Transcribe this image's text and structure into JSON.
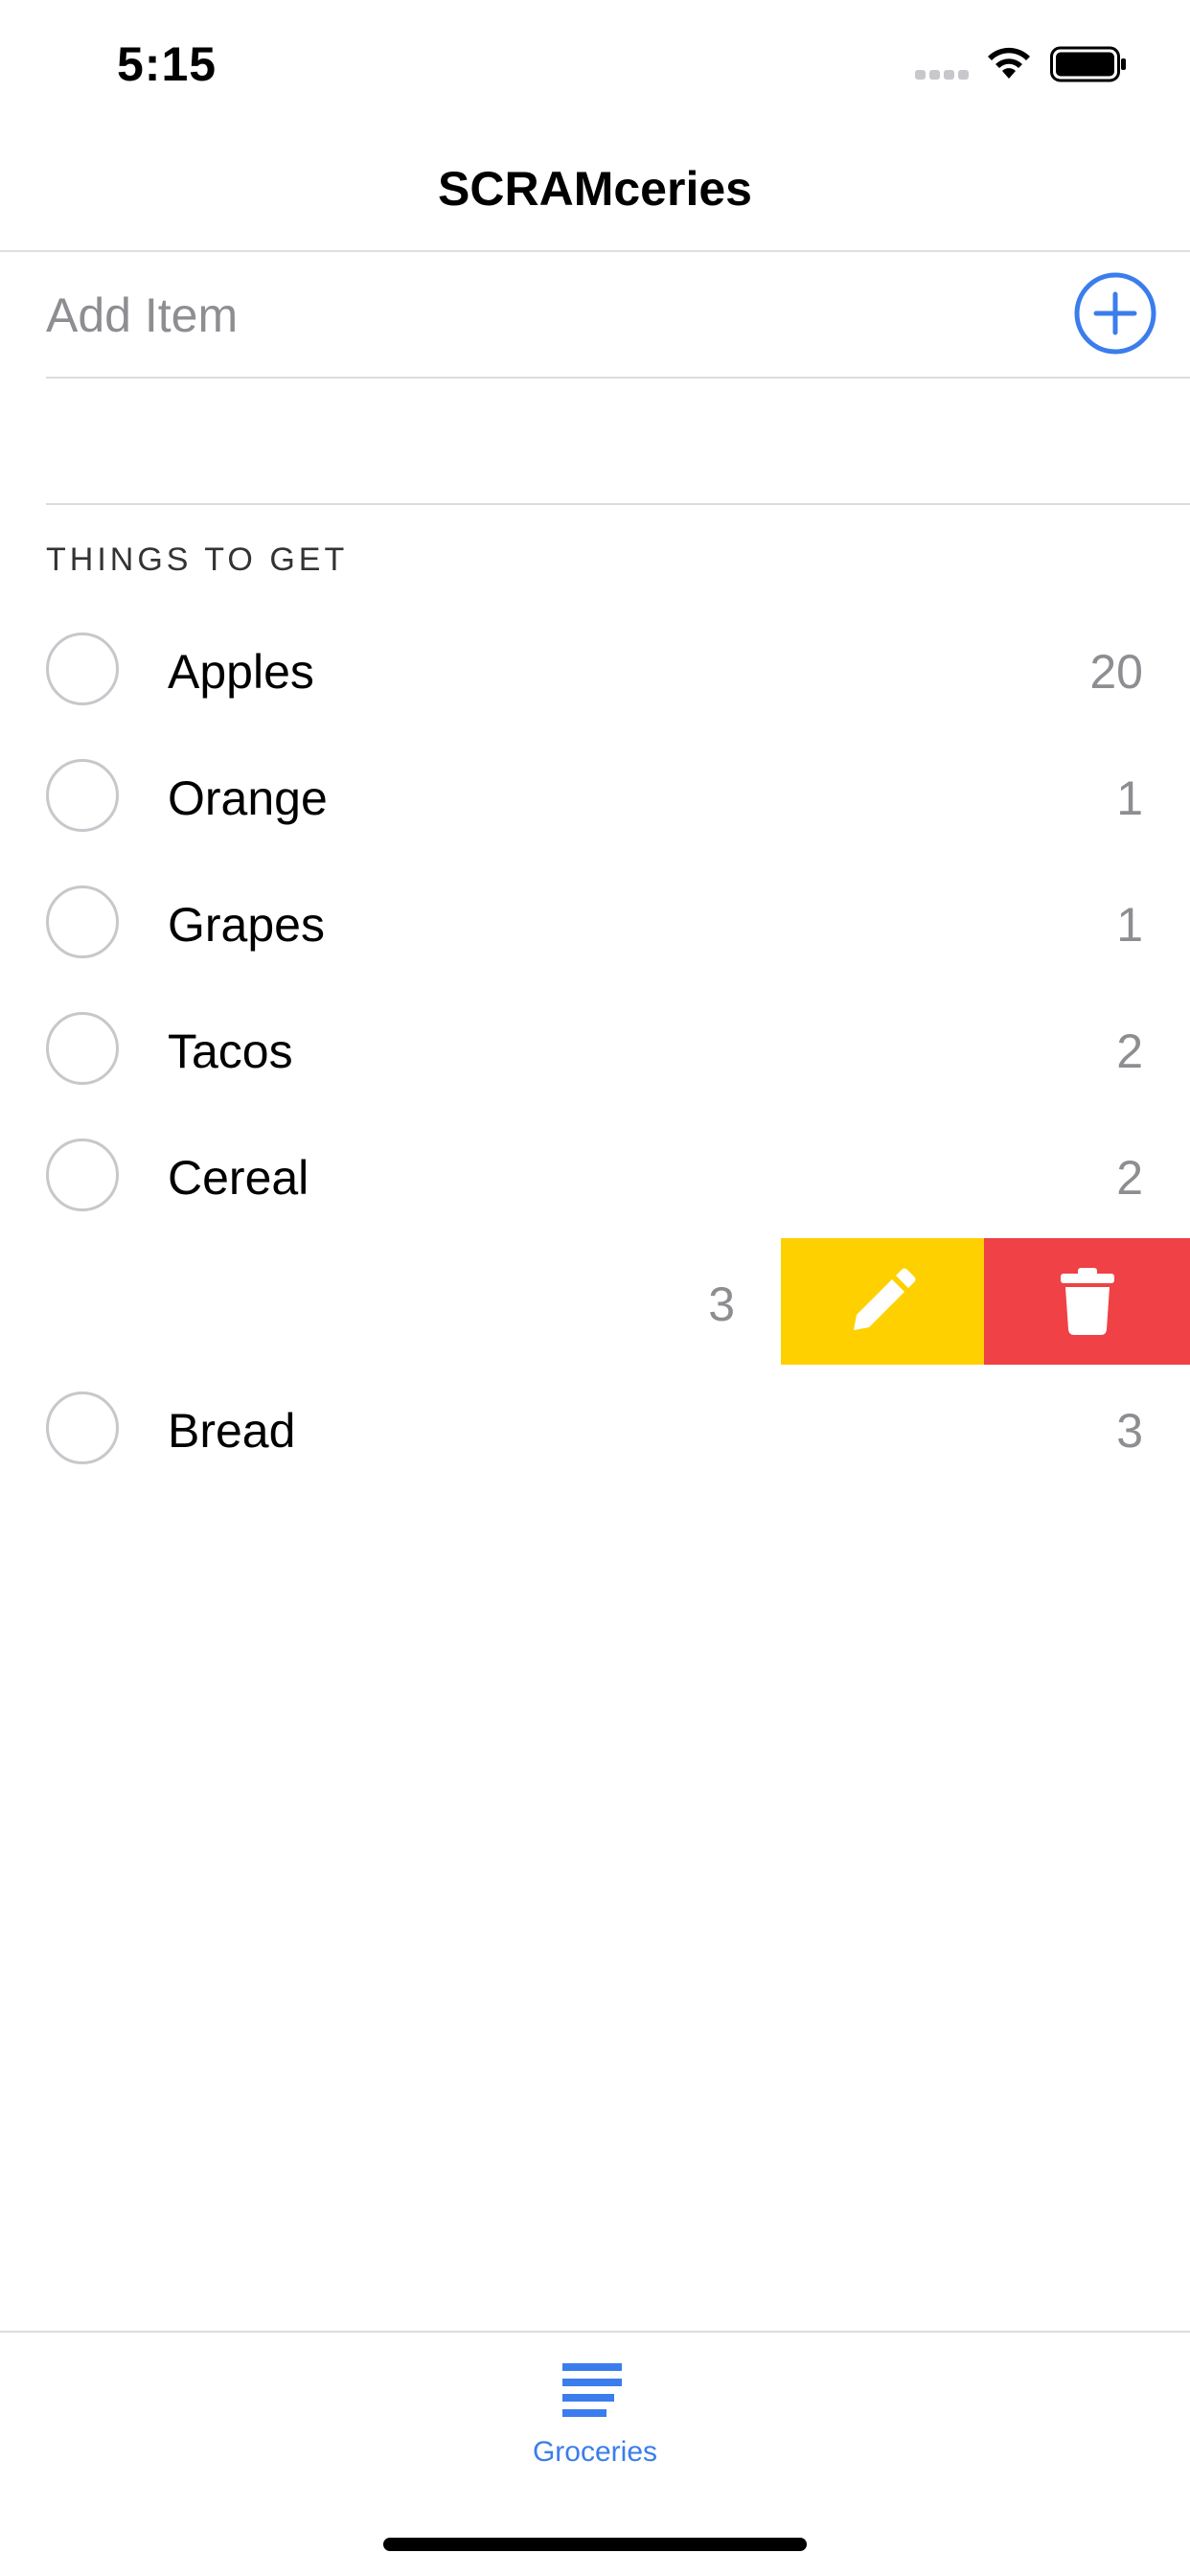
{
  "status_bar": {
    "time": "5:15",
    "icons": [
      "cellular-signal-icon",
      "wifi-icon",
      "battery-icon"
    ]
  },
  "nav": {
    "title": "SCRAMceries"
  },
  "add_item": {
    "placeholder": "Add Item",
    "value": "",
    "button_icon": "plus-circle-icon"
  },
  "section": {
    "header": "THINGS TO GET"
  },
  "items": [
    {
      "name": "Apples",
      "qty": "20"
    },
    {
      "name": "Orange",
      "qty": "1"
    },
    {
      "name": "Grapes",
      "qty": "1"
    },
    {
      "name": "Tacos",
      "qty": "2"
    },
    {
      "name": "Cereal",
      "qty": "2"
    }
  ],
  "swiped_item": {
    "qty": "3",
    "actions": [
      {
        "icon": "pencil-icon",
        "color": "#fed000"
      },
      {
        "icon": "trash-icon",
        "color": "#ef4146"
      }
    ]
  },
  "items_after": [
    {
      "name": "Bread",
      "qty": "3"
    }
  ],
  "tab_bar": {
    "tabs": [
      {
        "label": "Groceries",
        "icon": "list-icon",
        "active": true
      }
    ]
  },
  "colors": {
    "accent": "#3b7ded",
    "edit": "#fed000",
    "delete": "#ef4146",
    "secondary_text": "#8e8e92"
  }
}
